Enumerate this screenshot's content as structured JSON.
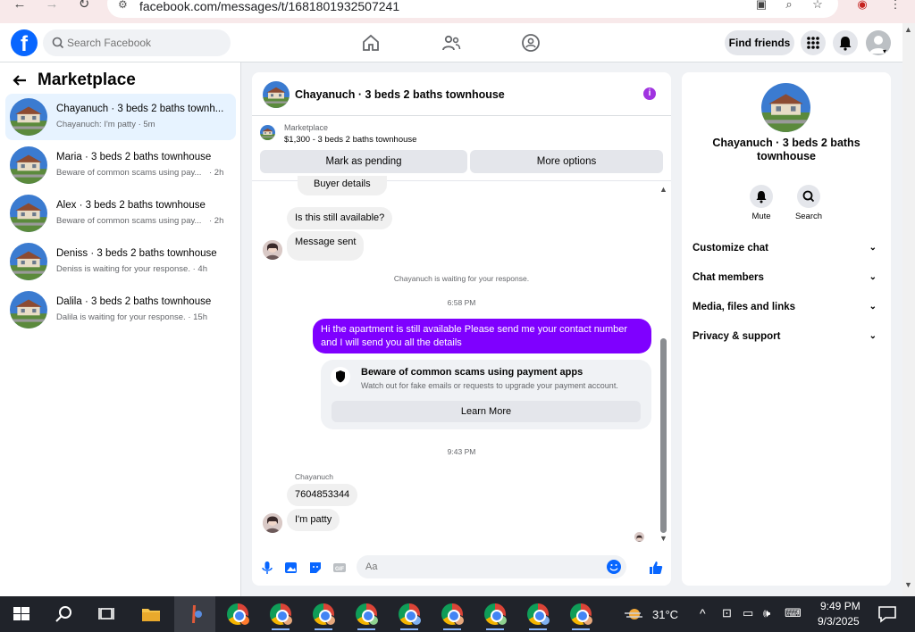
{
  "browser": {
    "url": "facebook.com/messages/t/1681801932507241"
  },
  "header": {
    "search_placeholder": "Search Facebook",
    "find_friends": "Find friends"
  },
  "left": {
    "title": "Marketplace",
    "conversations": [
      {
        "name": "Chayanuch · 3 beds 2 baths townh...",
        "preview": "Chayanuch: I'm patty",
        "time": "· 5m"
      },
      {
        "name": "Maria · 3 beds 2 baths townhouse",
        "preview": "Beware of common scams using pay...",
        "time": "· 2h"
      },
      {
        "name": "Alex · 3 beds 2 baths townhouse",
        "preview": "Beware of common scams using pay...",
        "time": "· 2h"
      },
      {
        "name": "Deniss · 3 beds 2 baths townhouse",
        "preview": "Deniss is waiting for your response.",
        "time": "· 4h"
      },
      {
        "name": "Dalila · 3 beds 2 baths townhouse",
        "preview": "Dalila is waiting for your response.",
        "time": "· 15h"
      }
    ]
  },
  "chat": {
    "title": "Chayanuch · 3 beds 2 baths townhouse",
    "listing_label": "Marketplace",
    "listing_price": "$1,300 - 3 beds 2 baths townhouse",
    "mark_pending": "Mark as pending",
    "more_options": "More options",
    "buyer_details": "Buyer details",
    "msg_available": "Is this still available?",
    "msg_sent": "Message sent",
    "waiting": "Chayanuch is waiting for your response.",
    "time1": "6:58 PM",
    "out_message": "Hi the apartment is still available Please send me your contact number and I will send you all the details",
    "scam_title": "Beware of common scams using payment apps",
    "scam_sub": "Watch out for fake emails or requests to upgrade your payment account.",
    "learn_more": "Learn More",
    "time2": "9:43 PM",
    "sender_name": "Chayanuch",
    "msg_number": "7604853344",
    "msg_patty": "I'm patty",
    "composer_placeholder": "Aa"
  },
  "right": {
    "name": "Chayanuch · 3 beds 2 baths townhouse",
    "mute": "Mute",
    "search": "Search",
    "items": [
      "Customize chat",
      "Chat members",
      "Media, files and links",
      "Privacy & support"
    ]
  },
  "taskbar": {
    "temperature": "31°C",
    "time": "9:49 PM",
    "date": "9/3/2025"
  },
  "colors": {
    "brand": "#0866ff",
    "message_purple": "#7f00ff",
    "active_row": "#e7f3ff"
  }
}
